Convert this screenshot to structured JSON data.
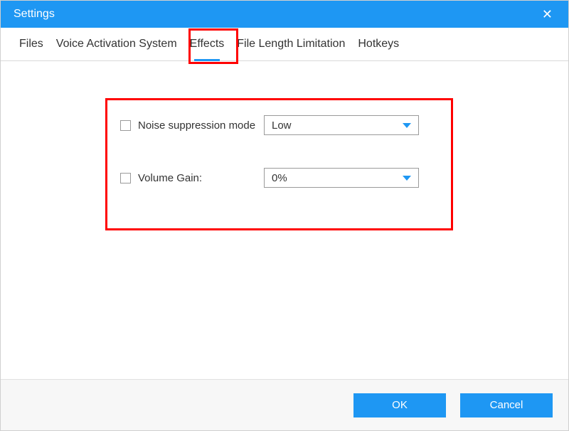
{
  "window": {
    "title": "Settings"
  },
  "tabs": {
    "files": "Files",
    "voice_activation": "Voice Activation System",
    "effects": "Effects",
    "file_length": "File Length Limitation",
    "hotkeys": "Hotkeys"
  },
  "effects_panel": {
    "noise_label": "Noise suppression mode",
    "noise_value": "Low",
    "volume_label": "Volume Gain:",
    "volume_value": "0%"
  },
  "footer": {
    "ok": "OK",
    "cancel": "Cancel"
  }
}
